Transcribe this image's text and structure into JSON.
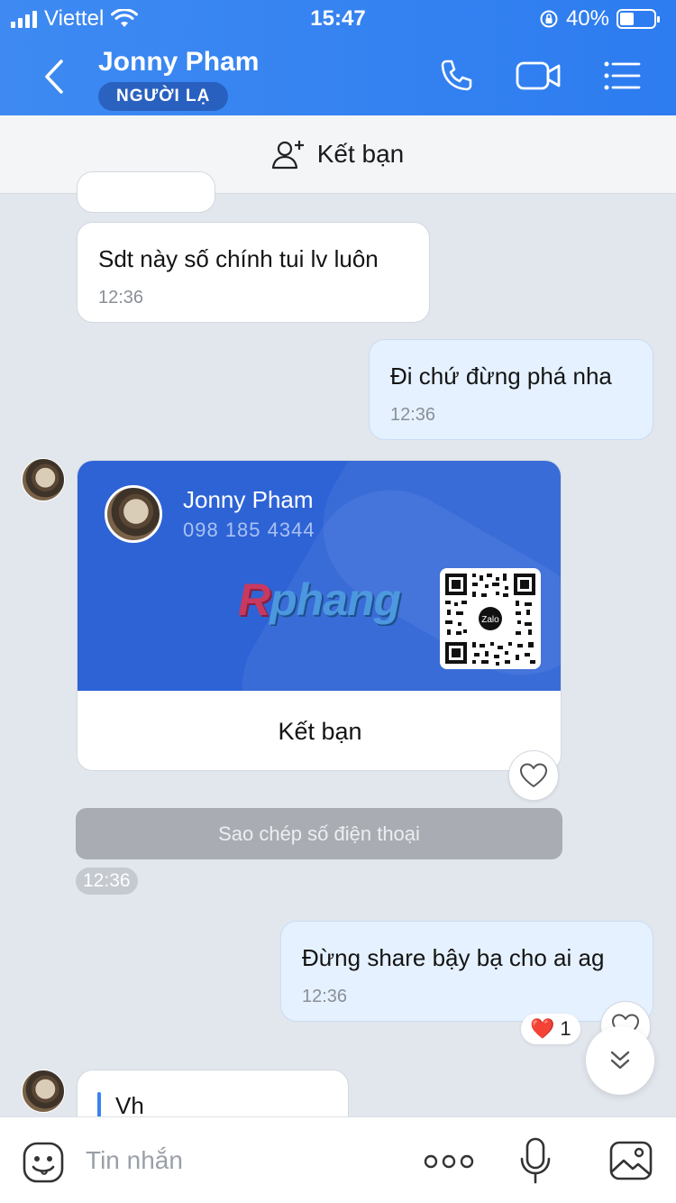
{
  "status_bar": {
    "carrier": "Viettel",
    "time": "15:47",
    "battery": "40%"
  },
  "header": {
    "title": "Jonny Pham",
    "badge": "NGƯỜI LẠ",
    "icons": [
      "back-icon",
      "phone-icon",
      "video-call-icon",
      "menu-list-icon"
    ]
  },
  "add_friend_bar": {
    "label": "Kết bạn"
  },
  "messages": [
    {
      "direction": "in",
      "text": "Sdt này số chính tui lv luôn",
      "time": "12:36"
    },
    {
      "direction": "out",
      "text": "Đi chứ đừng phá nha",
      "time": "12:36"
    },
    {
      "direction": "out",
      "text": "Đừng share bậy bạ cho ai ag",
      "time": "12:36",
      "reaction": {
        "emoji": "❤️",
        "count": "1"
      }
    }
  ],
  "contact_card": {
    "name": "Jonny Pham",
    "phone": "098 185 4344",
    "watermark_part1": "R",
    "watermark_part2": "phang",
    "qr_label": "Zalo",
    "button": "Kết bạn",
    "copy_button": "Sao chép số điện thoại",
    "time": "12:36"
  },
  "quoted_message": {
    "text": "Vh"
  },
  "composer": {
    "placeholder": "Tin nhắn",
    "icons": [
      "sticker-icon",
      "more-icon",
      "microphone-icon",
      "image-icon"
    ]
  },
  "colors": {
    "header_blue": "#2d7cf0",
    "card_blue": "#2e63d6",
    "outgoing_bubble": "#e5f1ff",
    "background": "#e2e6ed"
  }
}
